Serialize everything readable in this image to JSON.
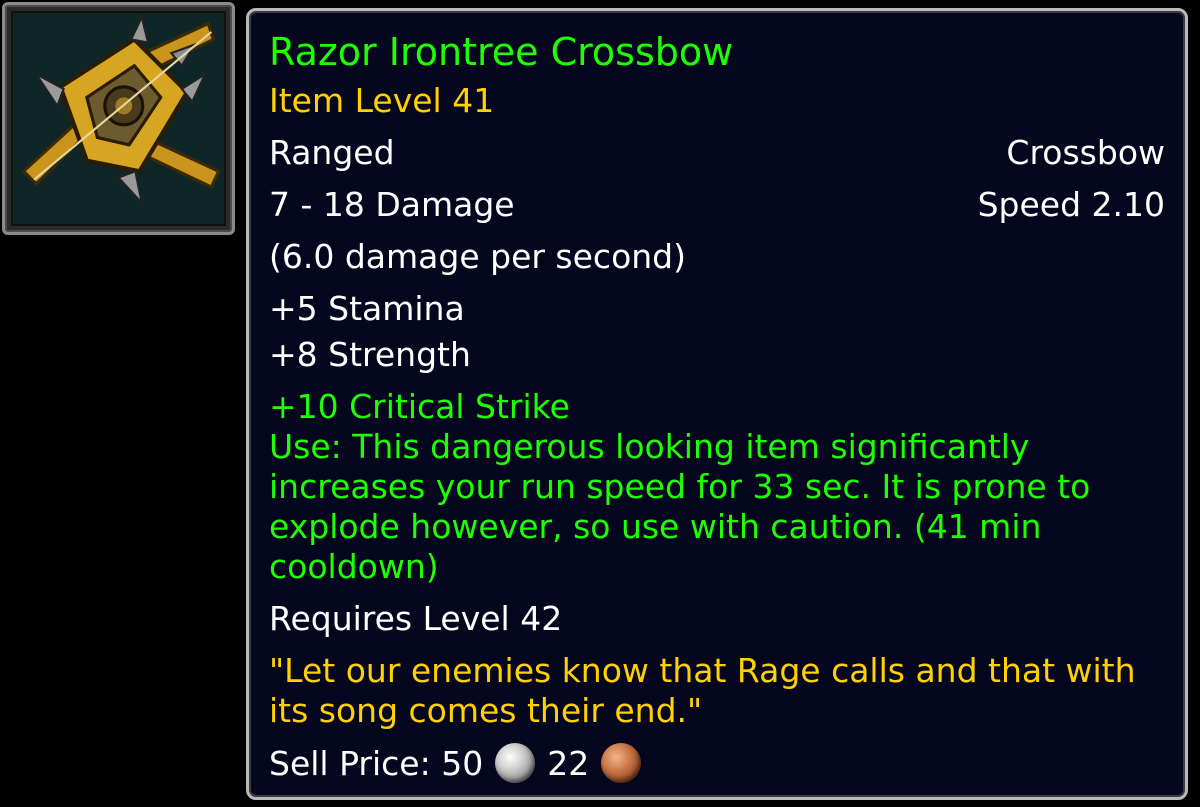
{
  "item": {
    "name": "Razor Irontree Crossbow",
    "item_level": "Item Level 41",
    "slot": "Ranged",
    "type": "Crossbow",
    "damage": "7 - 18 Damage",
    "speed": "Speed 2.10",
    "dps": "(6.0 damage per second)",
    "stats": [
      "+5 Stamina",
      "+8 Strength"
    ],
    "bonus": "+10 Critical Strike",
    "use_text": "Use: This dangerous looking item significantly increases your run speed for 33 sec. It is prone to explode however, so use with caution. (41 min cooldown)",
    "requirement": "Requires Level 42",
    "flavor": "\"Let our enemies know that Rage calls and that with its song comes their end.\"",
    "sell_label": "Sell Price:",
    "sell_silver": "50",
    "sell_copper": "22"
  },
  "icons": {
    "item": "crossbow-icon",
    "silver": "silver-coin-icon",
    "copper": "copper-coin-icon"
  },
  "colors": {
    "item_name": "#1eff00",
    "item_level": "#ffd100",
    "effect": "#1eff00",
    "flavor": "#ffd100",
    "text": "#ffffff",
    "background": "#05071f",
    "border": "#b9b9b9"
  }
}
